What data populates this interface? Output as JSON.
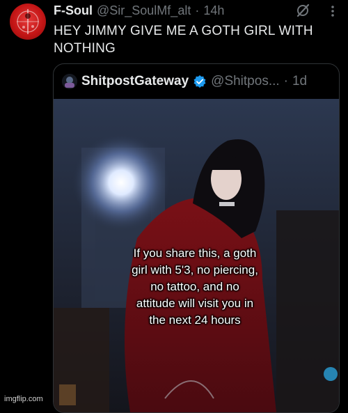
{
  "tweet": {
    "name": "F-Soul",
    "handle": "@Sir_SoulMf_alt",
    "separator": "·",
    "time": "14h",
    "text_line1": "HEY JIMMY GIVE ME A GOTH GIRL WITH",
    "text_line2": "NOTHING",
    "avatar_icon": "red-circle-avatar-icon",
    "grok_icon": "grok-icon",
    "more_icon": "more-dots-icon"
  },
  "quote": {
    "name": "ShitpostGateway",
    "verified_icon": "verified-badge-icon",
    "verified_color": "#1d9bf0",
    "handle": "@Shitpos...",
    "separator": "·",
    "time": "1d",
    "media_caption_lines": [
      "If you share this, a goth",
      "girl with 5'3, no piercing,",
      "no tattoo, and no",
      "attitude will visit you in",
      "the next 24 hours"
    ]
  },
  "watermark": "imgflip.com",
  "colors": {
    "background": "#000000",
    "text": "#e7e9ea",
    "muted": "#71767b",
    "border": "#2f3336"
  }
}
